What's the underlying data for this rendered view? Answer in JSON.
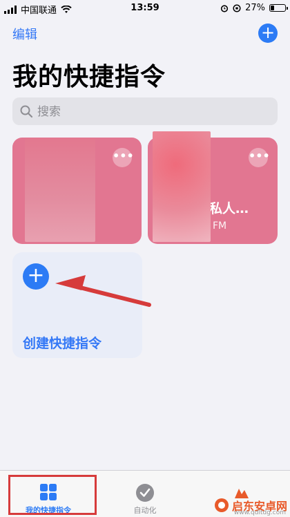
{
  "status_bar": {
    "carrier": "中国联通",
    "time": "13:59",
    "battery": "27%",
    "battery_level": 0.27
  },
  "nav": {
    "edit_label": "编辑",
    "add_icon": "plus-icon"
  },
  "page_title": "我的快捷指令",
  "search": {
    "placeholder": "搜索"
  },
  "shortcuts": [
    {
      "title": "",
      "subtitle": "",
      "color": "#e27691"
    },
    {
      "title": "易私人…",
      "subtitle": "FM",
      "color": "#e27691"
    }
  ],
  "create_card": {
    "label": "创建快捷指令",
    "icon": "plus-icon"
  },
  "tabs": [
    {
      "label": "我的快捷指令",
      "icon": "grid-icon",
      "active": true
    },
    {
      "label": "自动化",
      "icon": "clock-check-icon",
      "active": false
    },
    {
      "label": "",
      "icon": "gallery-icon",
      "active": false
    }
  ],
  "watermark": {
    "text": "启东安卓网",
    "url": "www.qdltdg.com"
  },
  "colors": {
    "accent": "#2c7bf5",
    "card_pink": "#e27691",
    "annotation_red": "#d63b3b"
  }
}
